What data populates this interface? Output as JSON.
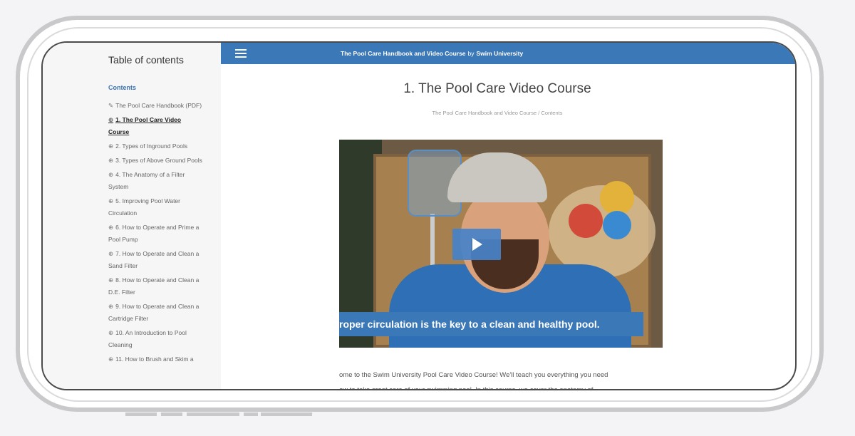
{
  "toc": {
    "title": "Table of contents",
    "heading": "Contents",
    "items": [
      {
        "icon": "✎",
        "label": "The Pool Care Handbook (PDF)",
        "active": false
      },
      {
        "icon": "⊕",
        "label": "1. The Pool Care Video Course",
        "active": true
      },
      {
        "icon": "⊕",
        "label": "2. Types of Inground Pools",
        "active": false
      },
      {
        "icon": "⊕",
        "label": "3. Types of Above Ground Pools",
        "active": false
      },
      {
        "icon": "⊕",
        "label": "4. The Anatomy of a Filter System",
        "active": false
      },
      {
        "icon": "⊕",
        "label": "5. Improving Pool Water Circulation",
        "active": false
      },
      {
        "icon": "⊕",
        "label": "6. How to Operate and Prime a Pool Pump",
        "active": false
      },
      {
        "icon": "⊕",
        "label": "7. How to Operate and Clean a Sand Filter",
        "active": false
      },
      {
        "icon": "⊕",
        "label": "8. How to Operate and Clean a D.E. Filter",
        "active": false
      },
      {
        "icon": "⊕",
        "label": "9. How to Operate and Clean a Cartridge Filter",
        "active": false
      },
      {
        "icon": "⊕",
        "label": "10. An Introduction to Pool Cleaning",
        "active": false
      },
      {
        "icon": "⊕",
        "label": "11. How to Brush and Skim a",
        "active": false
      }
    ]
  },
  "topbar": {
    "book_title": "The Pool Care Handbook and Video Course",
    "by": "by",
    "author": "Swim University"
  },
  "page": {
    "title": "1. The Pool Care Video Course",
    "breadcrumb": "The Pool Care Handbook and Video Course  /  Contents"
  },
  "video": {
    "caption": "roper circulation is the key to a clean and healthy pool."
  },
  "body": {
    "line1": "ome to the Swim University Pool Care Video Course! We'll teach you everything you need",
    "line2": "ow to take great care of your swimming pool. In this course, we cover the anatomy of"
  },
  "colors": {
    "accent": "#3b78b7",
    "sidebar_bg": "#f6f6f7"
  }
}
